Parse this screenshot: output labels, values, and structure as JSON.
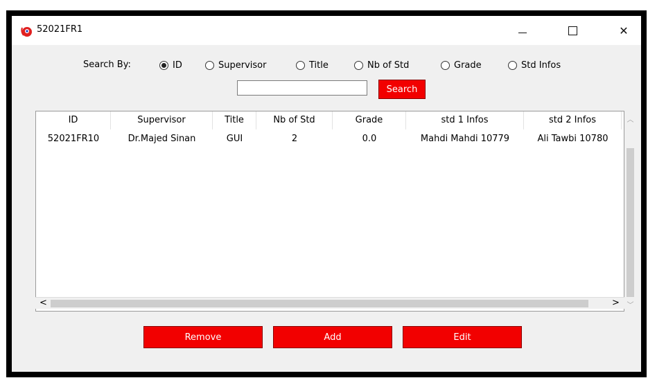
{
  "window": {
    "title": "52021FR1",
    "controls": {
      "minimize": "—",
      "maximize": "☐",
      "close": "✕"
    }
  },
  "search": {
    "label": "Search By:",
    "options": [
      {
        "label": "ID",
        "selected": true
      },
      {
        "label": "Supervisor",
        "selected": false
      },
      {
        "label": "Title",
        "selected": false
      },
      {
        "label": "Nb of Std",
        "selected": false
      },
      {
        "label": "Grade",
        "selected": false
      },
      {
        "label": "Std Infos",
        "selected": false
      }
    ],
    "input_value": "",
    "button_label": "Search"
  },
  "table": {
    "columns": [
      "ID",
      "Supervisor",
      "Title",
      "Nb of Std",
      "Grade",
      "std 1 Infos",
      "std 2 Infos"
    ],
    "rows": [
      [
        "52021FR10",
        "Dr.Majed Sinan",
        "GUI",
        "2",
        "0.0",
        "Mahdi Mahdi 10779",
        "Ali Tawbi 10780"
      ]
    ]
  },
  "actions": {
    "remove_label": "Remove",
    "add_label": "Add",
    "edit_label": "Edit"
  },
  "colors": {
    "accent": "#f20000",
    "window_bg": "#f0f0f0",
    "frame": "#000000"
  }
}
